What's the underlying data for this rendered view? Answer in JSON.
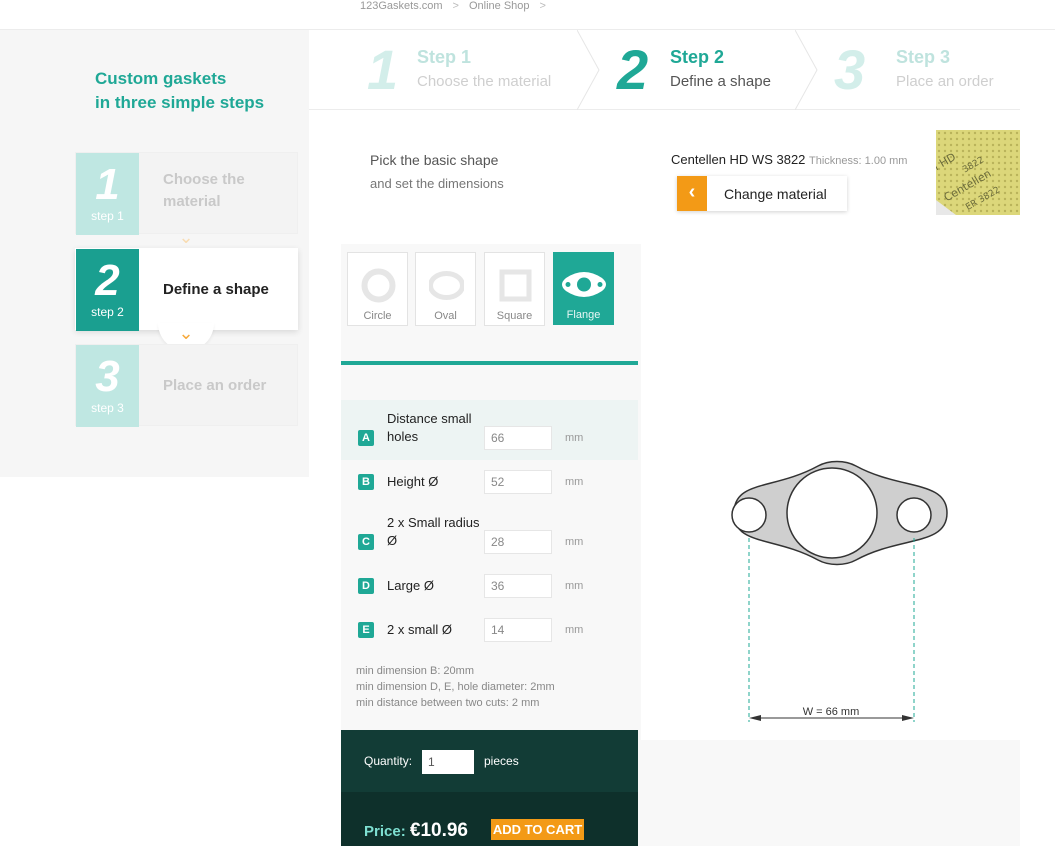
{
  "breadcrumb": {
    "items": [
      "123Gaskets.com",
      "Online Shop"
    ]
  },
  "sidebar": {
    "title_line1": "Custom gaskets",
    "title_line2": "in three simple steps",
    "steps": [
      {
        "number": "1",
        "label": "step 1",
        "text_line1": "Choose the",
        "text_line2": "material"
      },
      {
        "number": "2",
        "label": "step 2",
        "text": "Define a shape"
      },
      {
        "number": "3",
        "label": "step 3",
        "text": "Place an order"
      }
    ]
  },
  "header": {
    "steps": [
      {
        "number": "1",
        "title": "Step 1",
        "subtitle": "Choose the material"
      },
      {
        "number": "2",
        "title": "Step 2",
        "subtitle": "Define a shape"
      },
      {
        "number": "3",
        "title": "Step 3",
        "subtitle": "Place an order"
      }
    ]
  },
  "info": {
    "pick_line1": "Pick the basic shape",
    "pick_line2": "and set the dimensions",
    "material_name": "Centellen HD WS 3822",
    "thickness": "Thickness: 1.00 mm",
    "change_button": "Change material"
  },
  "shapes": [
    {
      "label": "Circle"
    },
    {
      "label": "Oval"
    },
    {
      "label": "Square"
    },
    {
      "label": "Flange",
      "selected": true
    }
  ],
  "fields": [
    {
      "letter": "A",
      "label_line1": "Distance small",
      "label_line2": "holes",
      "value": "66",
      "unit": "mm"
    },
    {
      "letter": "B",
      "label": "Height Ø",
      "value": "52",
      "unit": "mm"
    },
    {
      "letter": "C",
      "label_line1": "2 x Small radius",
      "label_line2": "Ø",
      "value": "28",
      "unit": "mm"
    },
    {
      "letter": "D",
      "label": "Large Ø",
      "value": "36",
      "unit": "mm"
    },
    {
      "letter": "E",
      "label": "2 x small Ø",
      "value": "14",
      "unit": "mm"
    }
  ],
  "notes": [
    "min dimension B: 20mm",
    "min dimension D, E, hole diameter: 2mm",
    "min distance between two cuts: 2 mm"
  ],
  "order": {
    "quantity_label": "Quantity:",
    "quantity_value": "1",
    "pieces_label": "pieces",
    "price_label": "Price:",
    "price_value": "€10.96",
    "cart_button": "ADD TO CART"
  },
  "drawing": {
    "dimension_label": "W = 66 mm"
  },
  "colors": {
    "accent": "#1fa896",
    "orange": "#f39a16",
    "dark": "#123c36"
  }
}
